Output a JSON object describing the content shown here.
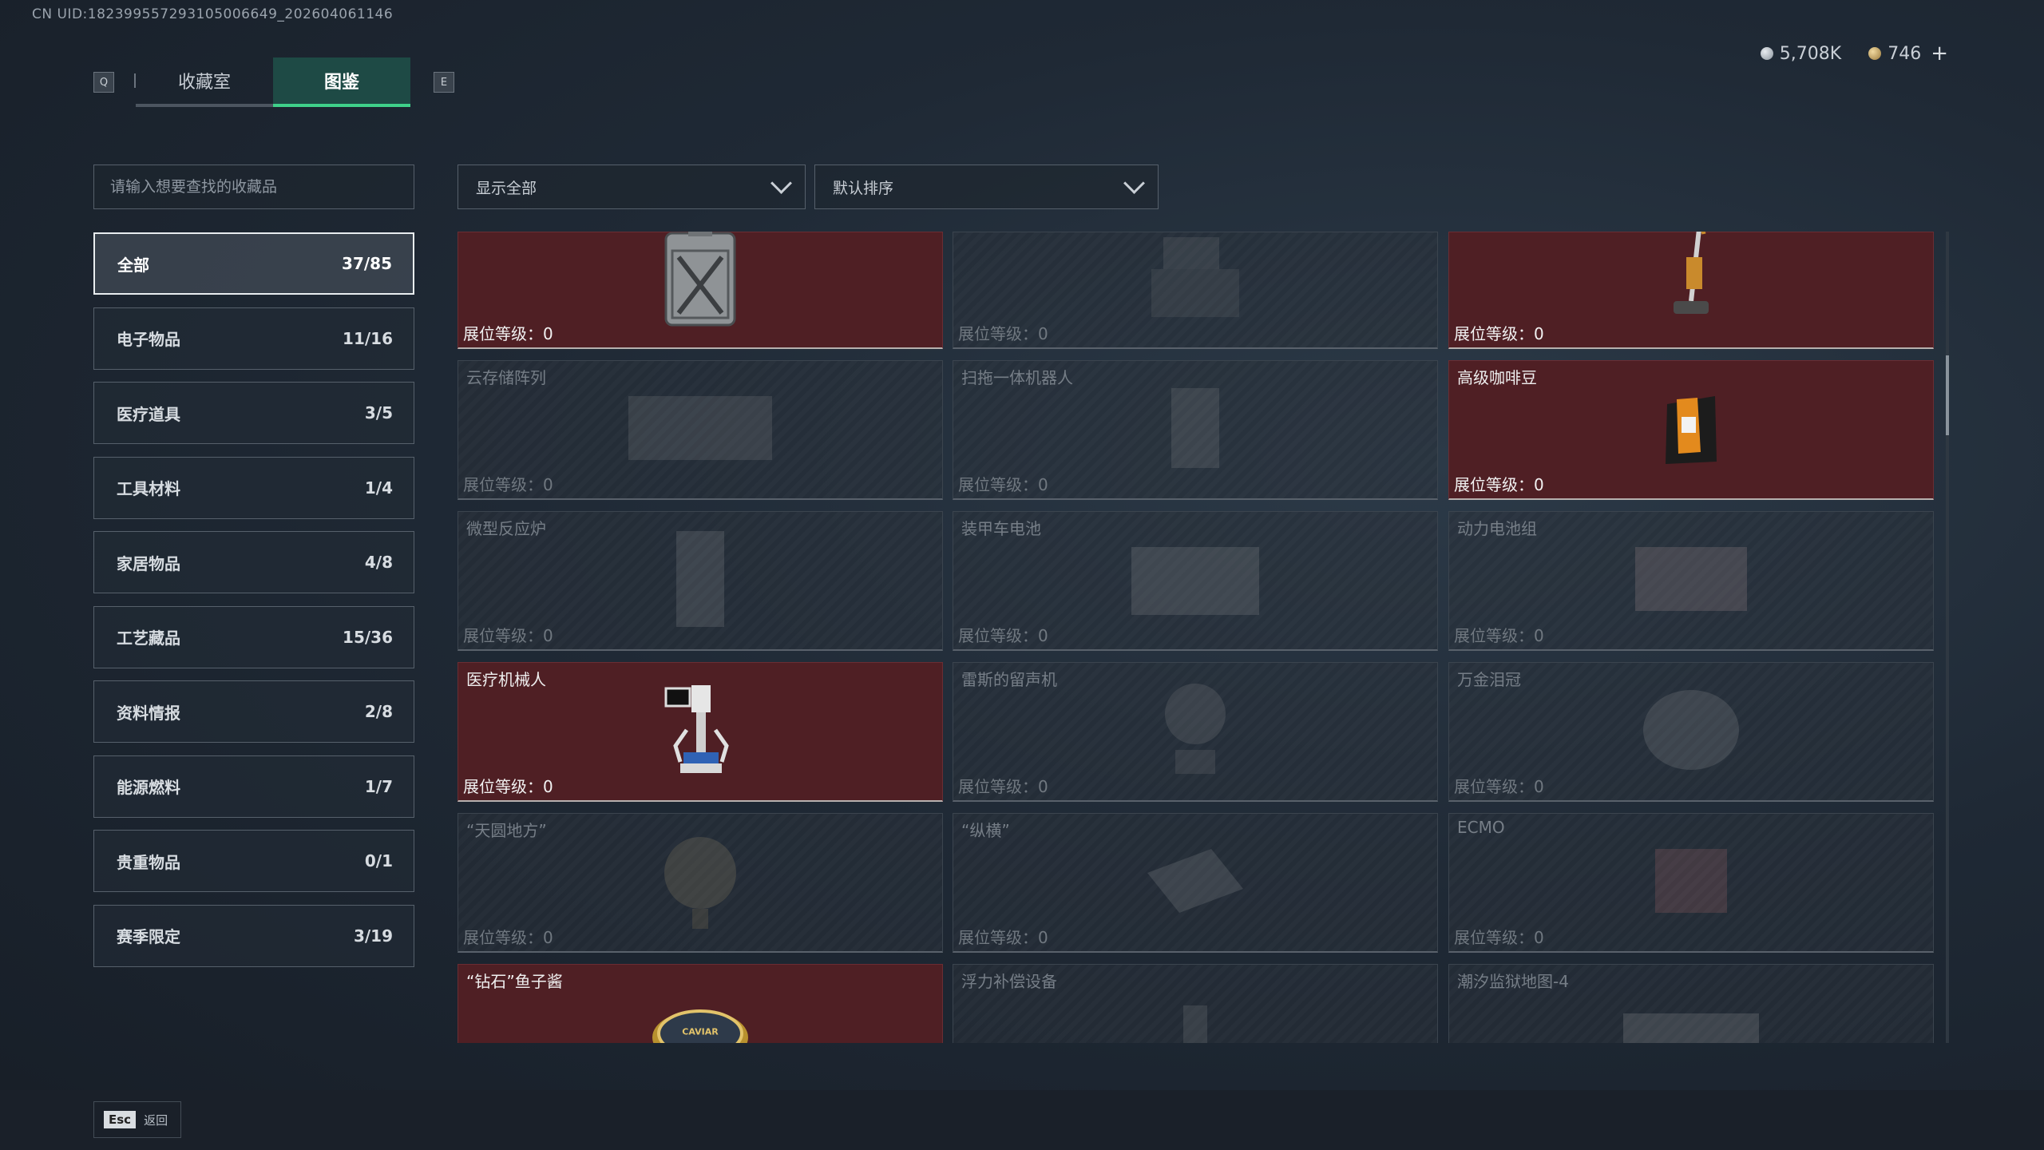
{
  "header": {
    "uid": "CN UID:18239955729310500​6649_202604061146",
    "tabs": [
      {
        "label": "收藏室",
        "active": false
      },
      {
        "label": "图鉴",
        "active": true
      }
    ],
    "left_key": "Q",
    "right_key": "E",
    "currency": {
      "silver": "5,708K",
      "gold": "746"
    }
  },
  "search": {
    "placeholder": "请输入想要查找的收藏品"
  },
  "filters": {
    "show": "显示全部",
    "sort": "默认排序"
  },
  "categories": [
    {
      "label": "全部",
      "count": "37/85",
      "active": true
    },
    {
      "label": "电子物品",
      "count": "11/16"
    },
    {
      "label": "医疗道具",
      "count": "3/5"
    },
    {
      "label": "工具材料",
      "count": "1/4"
    },
    {
      "label": "家居物品",
      "count": "4/8"
    },
    {
      "label": "工艺藏品",
      "count": "15/36"
    },
    {
      "label": "资料情报",
      "count": "2/8"
    },
    {
      "label": "能源燃料",
      "count": "1/7"
    },
    {
      "label": "贵重物品",
      "count": "0/1"
    },
    {
      "label": "赛季限定",
      "count": "3/19"
    }
  ],
  "level_label": "展位等级：",
  "items": [
    {
      "name": "",
      "level": "0",
      "owned": true,
      "icon": "fuel-can-icon"
    },
    {
      "name": "",
      "level": "0",
      "owned": false,
      "icon": "printer-icon"
    },
    {
      "name": "",
      "level": "0",
      "owned": true,
      "icon": "vacuum-icon"
    },
    {
      "name": "云存储阵列",
      "level": "0",
      "owned": false,
      "icon": "storage-array-icon"
    },
    {
      "name": "扫拖一体机器人",
      "level": "0",
      "owned": false,
      "icon": "mop-robot-icon"
    },
    {
      "name": "高级咖啡豆",
      "level": "0",
      "owned": true,
      "icon": "coffee-bag-icon"
    },
    {
      "name": "微型反应炉",
      "level": "0",
      "owned": false,
      "icon": "reactor-icon"
    },
    {
      "name": "装甲车电池",
      "level": "0",
      "owned": false,
      "icon": "battery-icon"
    },
    {
      "name": "动力电池组",
      "level": "0",
      "owned": false,
      "icon": "battery-pack-icon"
    },
    {
      "name": "医疗机械人",
      "level": "0",
      "owned": true,
      "icon": "medical-robot-icon"
    },
    {
      "name": "雷斯的留声机",
      "level": "0",
      "owned": false,
      "icon": "gramophone-icon"
    },
    {
      "name": "万金泪冠",
      "level": "0",
      "owned": false,
      "icon": "crown-icon"
    },
    {
      "name": "“天圆地方”",
      "level": "0",
      "owned": false,
      "icon": "globe-icon"
    },
    {
      "name": "“纵横”",
      "level": "0",
      "owned": false,
      "icon": "board-icon"
    },
    {
      "name": "ECMO",
      "level": "0",
      "owned": false,
      "icon": "ecmo-icon"
    },
    {
      "name": "“钻石”鱼子酱",
      "level": "",
      "owned": true,
      "icon": "caviar-tin-icon"
    },
    {
      "name": "浮力补偿设备",
      "level": "",
      "owned": false,
      "icon": "buoyancy-icon"
    },
    {
      "name": "潮汐监狱地图-4",
      "level": "",
      "owned": false,
      "icon": "map-icon"
    }
  ],
  "caviar_label": "CAVIAR",
  "footer": {
    "esc_key": "Esc",
    "esc_label": "返回"
  }
}
